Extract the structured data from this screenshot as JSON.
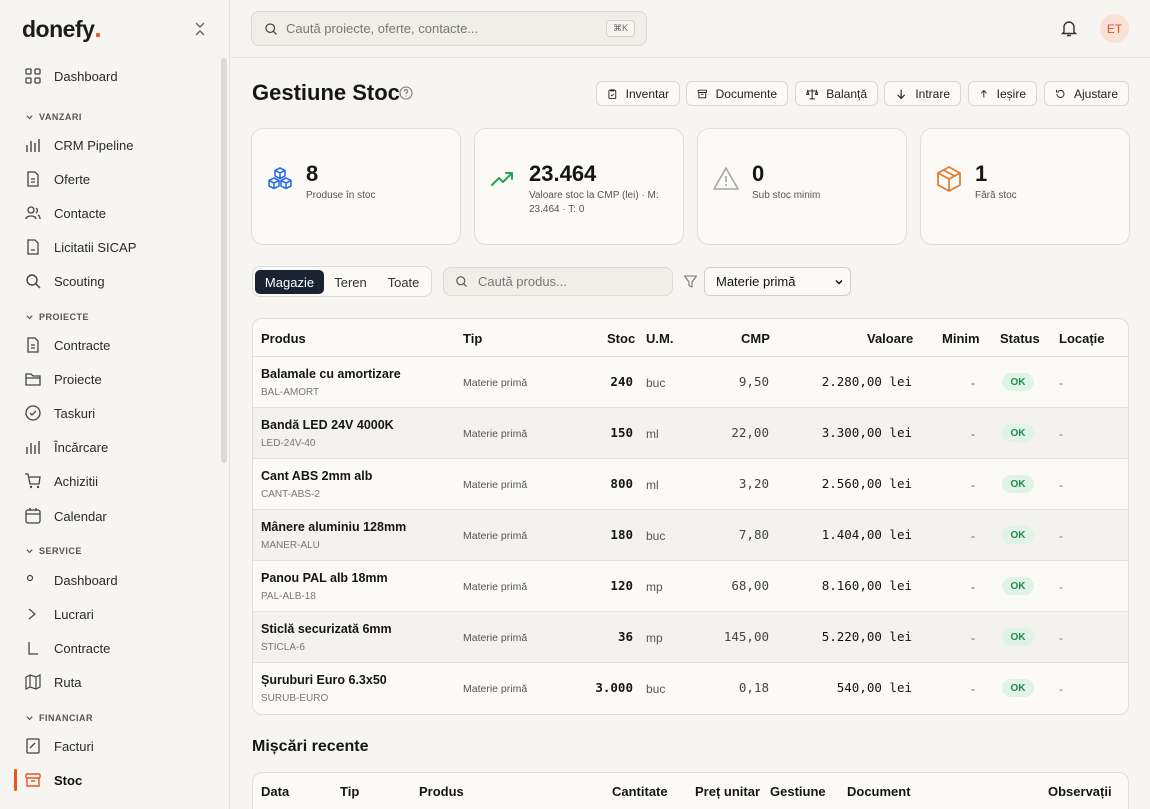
{
  "app": {
    "logo": "donefy",
    "logo_dot": "."
  },
  "sidebar": {
    "dashboard": "Dashboard",
    "sections": [
      {
        "label": "VANZARI",
        "items": [
          "CRM Pipeline",
          "Oferte",
          "Contacte",
          "Licitatii SICAP",
          "Scouting"
        ]
      },
      {
        "label": "PROIECTE",
        "items": [
          "Contracte",
          "Proiecte",
          "Taskuri",
          "Încărcare",
          "Achizitii",
          "Calendar"
        ]
      },
      {
        "label": "SERVICE",
        "items": [
          "Dashboard",
          "Lucrari",
          "Contracte",
          "Ruta"
        ]
      },
      {
        "label": "FINANCIAR",
        "items": [
          "Facturi",
          "Stoc"
        ]
      }
    ],
    "active_item": "Stoc"
  },
  "topbar": {
    "search_placeholder": "Caută proiecte, oferte, contacte...",
    "shortcut": "⌘K",
    "avatar_initials": "ET"
  },
  "page": {
    "title": "Gestiune Stoc",
    "actions": [
      "Inventar",
      "Documente",
      "Balanță",
      "Intrare",
      "Ieșire",
      "Ajustare"
    ]
  },
  "stats": [
    {
      "value": "8",
      "label": "Produse în stoc",
      "icon": "cubes-icon",
      "color": "#2f6fe0"
    },
    {
      "value": "23.464",
      "label": "Valoare stoc la CMP (lei) · M: 23.464 · T: 0",
      "icon": "trending-up-icon",
      "color": "#2aa152"
    },
    {
      "value": "0",
      "label": "Sub stoc minim",
      "icon": "warning-icon",
      "color": "#9a9a9a"
    },
    {
      "value": "1",
      "label": "Fără stoc",
      "icon": "box-icon",
      "color": "#e37a2a"
    }
  ],
  "filters": {
    "tabs": [
      "Magazie",
      "Teren",
      "Toate"
    ],
    "active_tab": "Magazie",
    "product_search_placeholder": "Caută produs...",
    "type_select": "Materie primă"
  },
  "stock_table": {
    "headers": [
      "Produs",
      "Tip",
      "Stoc",
      "U.M.",
      "CMP",
      "Valoare",
      "Minim",
      "Status",
      "Locație"
    ],
    "rows": [
      {
        "name": "Balamale cu amortizare",
        "code": "BAL-AMORT",
        "type": "Materie primă",
        "stock": "240",
        "um": "buc",
        "cmp": "9,50",
        "value": "2.280,00 lei",
        "min": "-",
        "status": "OK",
        "location": "-"
      },
      {
        "name": "Bandă LED 24V 4000K",
        "code": "LED-24V-40",
        "type": "Materie primă",
        "stock": "150",
        "um": "ml",
        "cmp": "22,00",
        "value": "3.300,00 lei",
        "min": "-",
        "status": "OK",
        "location": "-"
      },
      {
        "name": "Cant ABS 2mm alb",
        "code": "CANT-ABS-2",
        "type": "Materie primă",
        "stock": "800",
        "um": "ml",
        "cmp": "3,20",
        "value": "2.560,00 lei",
        "min": "-",
        "status": "OK",
        "location": "-"
      },
      {
        "name": "Mânere aluminiu 128mm",
        "code": "MANER-ALU",
        "type": "Materie primă",
        "stock": "180",
        "um": "buc",
        "cmp": "7,80",
        "value": "1.404,00 lei",
        "min": "-",
        "status": "OK",
        "location": "-"
      },
      {
        "name": "Panou PAL alb 18mm",
        "code": "PAL-ALB-18",
        "type": "Materie primă",
        "stock": "120",
        "um": "mp",
        "cmp": "68,00",
        "value": "8.160,00 lei",
        "min": "-",
        "status": "OK",
        "location": "-"
      },
      {
        "name": "Sticlă securizată 6mm",
        "code": "STICLA-6",
        "type": "Materie primă",
        "stock": "36",
        "um": "mp",
        "cmp": "145,00",
        "value": "5.220,00 lei",
        "min": "-",
        "status": "OK",
        "location": "-"
      },
      {
        "name": "Șuruburi Euro 6.3x50",
        "code": "SURUB-EURO",
        "type": "Materie primă",
        "stock": "3.000",
        "um": "buc",
        "cmp": "0,18",
        "value": "540,00 lei",
        "min": "-",
        "status": "OK",
        "location": "-"
      }
    ]
  },
  "recent": {
    "title": "Mișcări recente",
    "headers": [
      "Data",
      "Tip",
      "Produs",
      "Cantitate",
      "Preț unitar",
      "Gestiune",
      "Document",
      "Observații"
    ]
  }
}
